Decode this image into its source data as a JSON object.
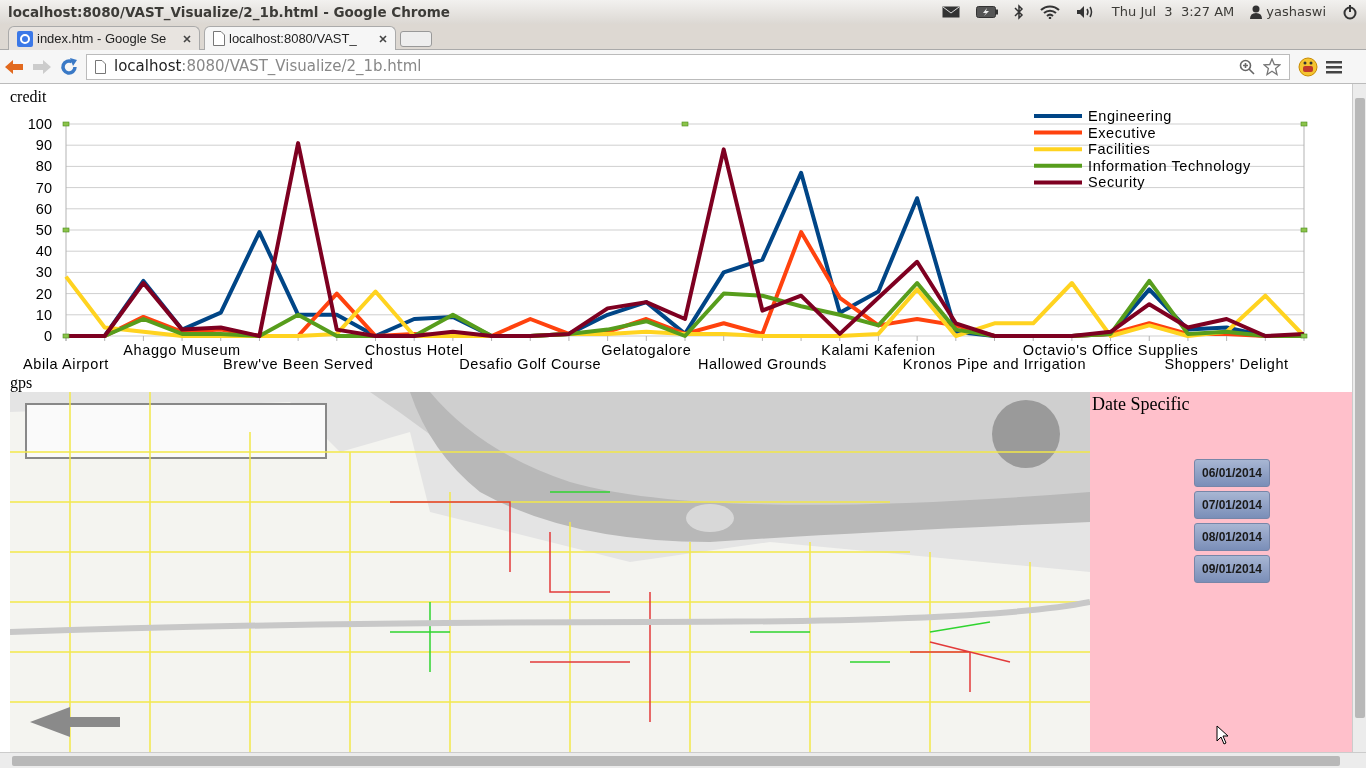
{
  "window": {
    "title": "localhost:8080/VAST_Visualize/2_1b.html - Google Chrome"
  },
  "system_tray": {
    "clock": "Thu Jul  3  3:27 AM",
    "user": "yashaswi"
  },
  "tabs": [
    {
      "label": "index.htm - Google Se",
      "selected": false
    },
    {
      "label": "localhost:8080/VAST_",
      "selected": true
    }
  ],
  "address_bar": {
    "host": "localhost",
    "path": ":8080/VAST_Visualize/2_1b.html"
  },
  "credit_chart": {
    "title": "credit",
    "chart_data": {
      "type": "line",
      "categories": [
        "Abila Airport",
        null,
        null,
        "Ahaggo Museum",
        null,
        null,
        "Brew've Been Served",
        null,
        null,
        "Chostus Hotel",
        null,
        null,
        "Desafio Golf Course",
        null,
        null,
        "Gelatogalore",
        null,
        null,
        "Hallowed Grounds",
        null,
        null,
        "Kalami Kafenion",
        null,
        null,
        "Kronos Pipe and Irrigation",
        null,
        null,
        "Octavio's Office Supplies",
        null,
        null,
        "Shoppers' Delight",
        null,
        null
      ],
      "ylim": [
        0,
        100
      ],
      "grid": true,
      "legend": true,
      "yticks": [
        0,
        10,
        20,
        30,
        40,
        50,
        60,
        70,
        80,
        90,
        100
      ],
      "series": [
        {
          "name": "Engineering",
          "color": "#004586",
          "values": [
            0,
            0,
            26,
            3,
            11,
            49,
            10,
            10,
            0,
            8,
            9,
            0,
            0,
            1,
            10,
            16,
            1,
            30,
            36,
            77,
            11,
            21,
            65,
            2,
            0,
            0,
            0,
            1,
            22,
            3,
            4,
            0,
            0
          ]
        },
        {
          "name": "Executive",
          "color": "#ff420e",
          "values": [
            0,
            0,
            9,
            2,
            3,
            0,
            0,
            20,
            0,
            1,
            0,
            0,
            8,
            1,
            2,
            8,
            1,
            6,
            1,
            49,
            18,
            5,
            8,
            5,
            0,
            0,
            0,
            1,
            6,
            1,
            1,
            0,
            0
          ]
        },
        {
          "name": "Facilities",
          "color": "#ffd320",
          "values": [
            28,
            4,
            2,
            0,
            0,
            0,
            0,
            1,
            21,
            0,
            0,
            0,
            0,
            1,
            1,
            2,
            1,
            1,
            0,
            0,
            0,
            1,
            22,
            0,
            6,
            6,
            25,
            0,
            5,
            0,
            2,
            19,
            0
          ]
        },
        {
          "name": "Information Technology",
          "color": "#579d1c",
          "values": [
            0,
            0,
            8,
            1,
            1,
            0,
            10,
            0,
            0,
            0,
            10,
            0,
            0,
            1,
            3,
            7,
            0,
            20,
            19,
            14,
            10,
            5,
            25,
            3,
            0,
            0,
            0,
            1,
            26,
            1,
            2,
            0,
            0
          ]
        },
        {
          "name": "Security",
          "color": "#7e0021",
          "values": [
            0,
            0,
            25,
            3,
            4,
            0,
            91,
            3,
            0,
            0,
            2,
            0,
            0,
            1,
            13,
            16,
            8,
            88,
            12,
            19,
            1,
            18,
            35,
            6,
            0,
            0,
            0,
            2,
            15,
            4,
            8,
            0,
            1
          ]
        }
      ]
    }
  },
  "gps": {
    "title": "gps"
  },
  "date_panel": {
    "title": "Date Specific",
    "buttons": [
      "06/01/2014",
      "07/01/2014",
      "08/01/2014",
      "09/01/2014"
    ]
  }
}
